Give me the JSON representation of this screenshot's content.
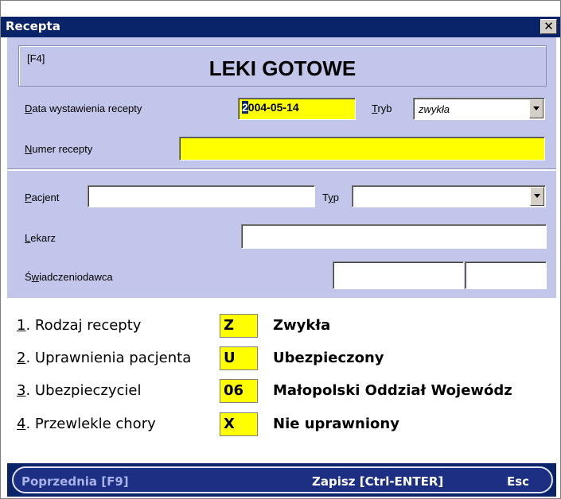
{
  "window": {
    "title": "Recepta",
    "close_glyph": "✕"
  },
  "header": {
    "hotkey": "[F4]",
    "title": "LEKI GOTOWE"
  },
  "form": {
    "date_label_u": "D",
    "date_label_rest": "ata wystawienia recepty",
    "date_value_first": "2",
    "date_value_rest": "004-05-14",
    "mode_label_u": "T",
    "mode_label_rest": "ryb",
    "mode_value": "zwykła",
    "number_label_u": "N",
    "number_label_rest": "umer recepty",
    "number_value": ""
  },
  "patient": {
    "patient_label_u": "P",
    "patient_label_rest": "acjent",
    "patient_value": "",
    "type_label_pre": "T",
    "type_label_u": "y",
    "type_label_rest": "p",
    "type_value": "",
    "doctor_label_u": "L",
    "doctor_label_rest": "ekarz",
    "doctor_value": "",
    "provider_label_pre": "Ś",
    "provider_label_u": "w",
    "provider_label_rest": "iadczeniodawca",
    "provider_value_1": "",
    "provider_value_2": ""
  },
  "rows": [
    {
      "num": "1",
      "label": ". Rodzaj recepty",
      "code": "Z",
      "value": "Zwykła"
    },
    {
      "num": "2",
      "label": ". Uprawnienia pacjenta",
      "code": "U",
      "value": "Ubezpieczony"
    },
    {
      "num": "3",
      "label": ". Ubezpieczyciel",
      "code": "06",
      "value": "Małopolski Oddział Wojewódz"
    },
    {
      "num": "4",
      "label": ". Przewlekle chory",
      "code": "X",
      "value": "Nie uprawniony"
    }
  ],
  "status": {
    "prev": "Poprzednia [F9]",
    "save": "Zapisz [Ctrl-ENTER]",
    "esc": "Esc"
  },
  "colors": {
    "title_bar": "#0a246a",
    "panel": "#c2c6ea",
    "highlight": "#ffff00"
  },
  "icons": {
    "close": "close-icon",
    "dropdown": "chevron-down-icon"
  }
}
